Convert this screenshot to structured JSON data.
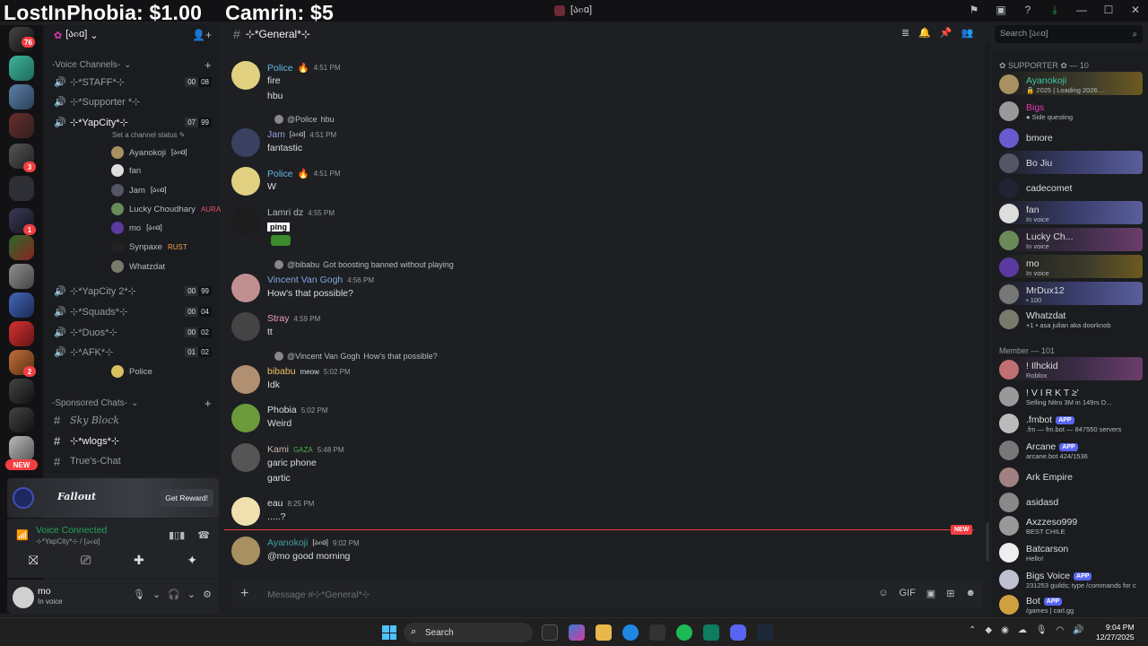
{
  "overlay": {
    "donation1": "LostInPhobia: $1.00",
    "donation2": "Camrin: $5"
  },
  "window": {
    "title": "[ა၈ɑ]"
  },
  "server": {
    "name": "[ა၈ɑ]",
    "rail_badges": [
      "76",
      "3",
      "1",
      "2"
    ],
    "new_label": "NEW"
  },
  "sidebar": {
    "voice_category": "-Voice Channels-",
    "channels": [
      {
        "name": "⊹*STAFF*⊹",
        "a": "00",
        "b": "08"
      },
      {
        "name": "⊹*Supporter *⊹",
        "a": "",
        "b": ""
      },
      {
        "name": "⊹*YapCity*⊹",
        "a": "07",
        "b": "99"
      },
      {
        "name": "⊹*YapCity 2*⊹",
        "a": "00",
        "b": "99"
      },
      {
        "name": "⊹*Squads*⊹",
        "a": "00",
        "b": "04"
      },
      {
        "name": "⊹*Duos*⊹",
        "a": "00",
        "b": "02"
      },
      {
        "name": "⊹*AFK*⊹",
        "a": "01",
        "b": "02"
      }
    ],
    "set_status": "Set a channel status",
    "voice_users": [
      {
        "name": "Ayanokoji",
        "tag": "[ა၈ɑ]"
      },
      {
        "name": "fan",
        "tag": ""
      },
      {
        "name": "Jam",
        "tag": "[ა၈ɑ]"
      },
      {
        "name": "Lucky Choudhary",
        "tag": "AURA"
      },
      {
        "name": "mo",
        "tag": "[ა၈ɑ]"
      },
      {
        "name": "Synpaxe",
        "tag": "RUST"
      },
      {
        "name": "Whatzdat",
        "tag": ""
      }
    ],
    "afk_user": "Police",
    "sponsored_category": "-Sponsored Chats-",
    "text_channels": [
      "Sky Block",
      "⊹*wlogs*⊹",
      "True's-Chat"
    ]
  },
  "promo": {
    "brand": "Fallout",
    "button": "Get Reward!"
  },
  "voice": {
    "status": "Voice Connected",
    "channel": "⊹*YapCity*⊹ / [ა၈ɑ]"
  },
  "user": {
    "name": "mo",
    "status": "In voice"
  },
  "chat": {
    "channel": "⊹*General*⊹",
    "messages": [
      {
        "author": "Police",
        "color": "#5fb8e8",
        "time": "4:51 PM",
        "tag": "",
        "lines": [
          "fire",
          "hbu"
        ],
        "reply": "",
        "reply_to": ""
      },
      {
        "author": "Jam",
        "color": "#8ea1e1",
        "time": "4:51 PM",
        "tag": "[ა၈ɑ]",
        "lines": [
          "fantastic"
        ],
        "reply": "hbu",
        "reply_to": "@Police"
      },
      {
        "author": "Police",
        "color": "#5fb8e8",
        "time": "4:51 PM",
        "tag": "",
        "lines": [
          "W"
        ],
        "reply": "",
        "reply_to": ""
      },
      {
        "author": "Lamri dz",
        "color": "#b5bac1",
        "time": "4:55 PM",
        "tag": "",
        "lines": [],
        "reply": "",
        "reply_to": ""
      },
      {
        "author": "Vincent Van Gogh",
        "color": "#7ea6e0",
        "time": "4:56 PM",
        "tag": "",
        "lines": [
          "How's that possible?"
        ],
        "reply": "Got boosting banned without playing",
        "reply_to": "@bibabu"
      },
      {
        "author": "Stray",
        "color": "#e8a0b8",
        "time": "4:59 PM",
        "tag": "",
        "lines": [
          "tt"
        ],
        "reply": "",
        "reply_to": ""
      },
      {
        "author": "bibabu",
        "color": "#f0c060",
        "time": "5:02 PM",
        "tag": "meow",
        "lines": [
          "Idk"
        ],
        "reply": "How's that possible?",
        "reply_to": "@Vincent Van Gogh"
      },
      {
        "author": "Phobia",
        "color": "#dbdee1",
        "time": "5:02 PM",
        "tag": "",
        "lines": [
          "Weird"
        ],
        "reply": "",
        "reply_to": ""
      },
      {
        "author": "Kami",
        "color": "#c8b8a8",
        "time": "5:48 PM",
        "tag": "GAZA",
        "lines": [
          "garic phone",
          "gartic"
        ],
        "reply": "",
        "reply_to": ""
      },
      {
        "author": "eau",
        "color": "#dbdee1",
        "time": "8:25 PM",
        "tag": "",
        "lines": [
          ".....?"
        ],
        "reply": "",
        "reply_to": ""
      },
      {
        "author": "Ayanokoji",
        "color": "#3f9fa6",
        "time": "9:02 PM",
        "tag": "[ა၈ɑ]",
        "lines": [
          "@mo good morning"
        ],
        "reply": "",
        "reply_to": ""
      }
    ],
    "ping_text": "ping",
    "new_label": "NEW",
    "composer_placeholder": "Message #⊹*General*⊹"
  },
  "search": {
    "placeholder": "Search [ა၈ɑ]"
  },
  "members": {
    "supporter_header": "✿ SUPPORTER ✿ — 10",
    "supporters": [
      {
        "name": "Ayanokoji",
        "sub": "🔒 2025 | Loading 2026 ...",
        "color": "#3fc6a8"
      },
      {
        "name": "Bigs",
        "sub": "● Side questing",
        "color": "#e03ab3"
      },
      {
        "name": "bmore",
        "sub": "",
        "color": "#c9a8ff"
      },
      {
        "name": "Bo Jiu",
        "sub": "",
        "color": "#c9a8ff"
      },
      {
        "name": "cadecomet",
        "sub": "",
        "color": "#c9a8ff"
      },
      {
        "name": "fan",
        "sub": "In voice",
        "color": "#c9a8ff"
      },
      {
        "name": "Lucky Ch...",
        "sub": "In voice",
        "color": "#c9a8ff"
      },
      {
        "name": "mo",
        "sub": "In voice",
        "color": "#c9a8ff"
      },
      {
        "name": "MrDux12",
        "sub": "• 100",
        "color": "#c9a8ff"
      },
      {
        "name": "Whatzdat",
        "sub": "+1 • asa julian aka doorknob",
        "color": "#c9a8ff"
      }
    ],
    "member_header": "Member — 101",
    "member_list": [
      {
        "name": "! Ilhckid",
        "sub": "Roblox",
        "app": false
      },
      {
        "name": "! V I R K T ≥'",
        "sub": "Selling Nitro 3M in 149rs D...",
        "app": false
      },
      {
        "name": ".fmbot",
        "sub": ".fm — fm.bot — 847550 servers",
        "app": true
      },
      {
        "name": "Arcane",
        "sub": "arcane.bot 424/1536",
        "app": true
      },
      {
        "name": "Ark Empire",
        "sub": "",
        "app": false
      },
      {
        "name": "asidasd",
        "sub": "",
        "app": false
      },
      {
        "name": "Axzzeso999",
        "sub": "BEST CHILE",
        "app": false
      },
      {
        "name": "Batcarson",
        "sub": "Hello!",
        "app": false
      },
      {
        "name": "Bigs Voice",
        "sub": "231253 guilds; type /commands for c",
        "app": true
      },
      {
        "name": "Bot",
        "sub": "/games | carl.gg",
        "app": true
      }
    ],
    "app_label": "APP"
  },
  "taskbar": {
    "search": "Search",
    "time": "9:04 PM",
    "date": "12/27/2025"
  }
}
